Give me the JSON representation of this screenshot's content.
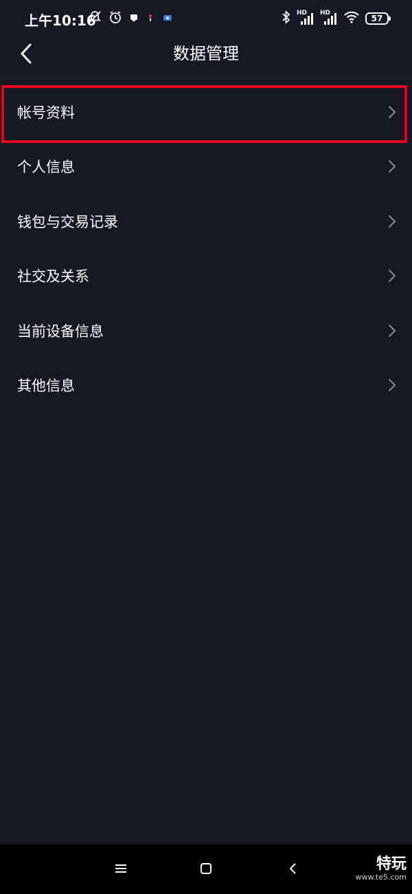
{
  "status_bar": {
    "time": "上午10:16",
    "battery": "57",
    "hd_label": "HD"
  },
  "header": {
    "title": "数据管理"
  },
  "menu": {
    "items": [
      {
        "label": "帐号资料"
      },
      {
        "label": "个人信息"
      },
      {
        "label": "钱包与交易记录"
      },
      {
        "label": "社交及关系"
      },
      {
        "label": "当前设备信息"
      },
      {
        "label": "其他信息"
      }
    ]
  },
  "annotation": {
    "highlight_color": "#e8001c"
  },
  "watermark": {
    "brand": "特玩",
    "url": "www.te5.com"
  },
  "colors": {
    "background": "#161823",
    "text": "#ffffff",
    "chevron": "#8a8b91"
  }
}
